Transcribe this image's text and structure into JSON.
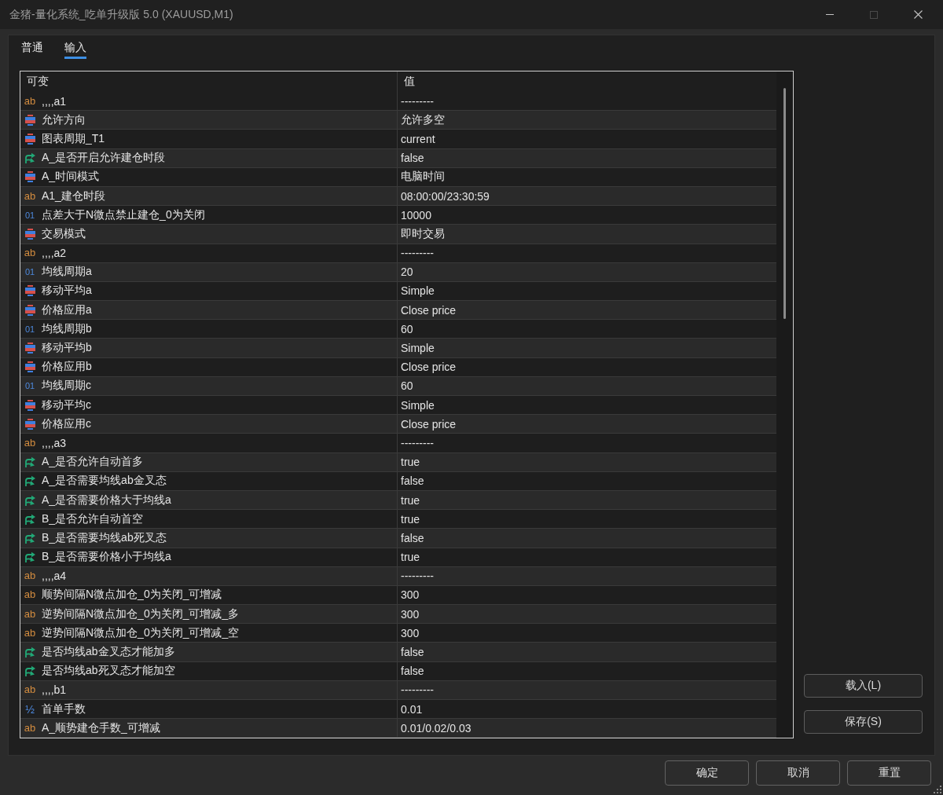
{
  "window": {
    "title": "金猪-量化系统_吃单升级版 5.0 (XAUUSD,M1)",
    "maximize_enabled": false
  },
  "tabs": [
    {
      "label": "普通",
      "selected": false
    },
    {
      "label": "输入",
      "selected": true
    }
  ],
  "table": {
    "columns": [
      "可变",
      "值"
    ],
    "rows": [
      {
        "kind": "string",
        "type_icon": "ab",
        "name": ",,,,a1",
        "value": "---------"
      },
      {
        "kind": "enum",
        "name": "允许方向",
        "value": "允许多空"
      },
      {
        "kind": "enum",
        "name": "图表周期_T1",
        "value": "current"
      },
      {
        "kind": "bool",
        "name": "A_是否开启允许建仓时段",
        "value": "false"
      },
      {
        "kind": "enum",
        "name": "A_时间模式",
        "value": "电脑时间"
      },
      {
        "kind": "string",
        "type_icon": "ab",
        "name": "A1_建仓时段",
        "value": "08:00:00/23:30:59"
      },
      {
        "kind": "int",
        "type_icon": "01",
        "name": "点差大于N微点禁止建仓_0为关闭",
        "value": "10000"
      },
      {
        "kind": "enum",
        "name": "交易模式",
        "value": "即时交易"
      },
      {
        "kind": "string",
        "type_icon": "ab",
        "name": ",,,,a2",
        "value": "---------"
      },
      {
        "kind": "int",
        "type_icon": "01",
        "name": "均线周期a",
        "value": "20"
      },
      {
        "kind": "enum",
        "name": "移动平均a",
        "value": "Simple"
      },
      {
        "kind": "enum",
        "name": "价格应用a",
        "value": "Close price"
      },
      {
        "kind": "int",
        "type_icon": "01",
        "name": "均线周期b",
        "value": "60"
      },
      {
        "kind": "enum",
        "name": "移动平均b",
        "value": "Simple"
      },
      {
        "kind": "enum",
        "name": "价格应用b",
        "value": "Close price"
      },
      {
        "kind": "int",
        "type_icon": "01",
        "name": "均线周期c",
        "value": "60"
      },
      {
        "kind": "enum",
        "name": "移动平均c",
        "value": "Simple"
      },
      {
        "kind": "enum",
        "name": "价格应用c",
        "value": "Close price"
      },
      {
        "kind": "string",
        "type_icon": "ab",
        "name": ",,,,a3",
        "value": "---------"
      },
      {
        "kind": "bool",
        "name": "A_是否允许自动首多",
        "value": "true"
      },
      {
        "kind": "bool",
        "name": "A_是否需要均线ab金叉态",
        "value": "false"
      },
      {
        "kind": "bool",
        "name": "A_是否需要价格大于均线a",
        "value": "true"
      },
      {
        "kind": "bool",
        "name": "B_是否允许自动首空",
        "value": "true"
      },
      {
        "kind": "bool",
        "name": "B_是否需要均线ab死叉态",
        "value": "false"
      },
      {
        "kind": "bool",
        "name": "B_是否需要价格小于均线a",
        "value": "true"
      },
      {
        "kind": "string",
        "type_icon": "ab",
        "name": ",,,,a4",
        "value": "---------"
      },
      {
        "kind": "string",
        "type_icon": "ab",
        "name": "顺势间隔N微点加仓_0为关闭_可增减",
        "value": "300"
      },
      {
        "kind": "string",
        "type_icon": "ab",
        "name": "逆势间隔N微点加仓_0为关闭_可增减_多",
        "value": "300"
      },
      {
        "kind": "string",
        "type_icon": "ab",
        "name": "逆势间隔N微点加仓_0为关闭_可增减_空",
        "value": "300"
      },
      {
        "kind": "bool",
        "name": "是否均线ab金叉态才能加多",
        "value": "false"
      },
      {
        "kind": "bool",
        "name": "是否均线ab死叉态才能加空",
        "value": "false"
      },
      {
        "kind": "string",
        "type_icon": "ab",
        "name": ",,,,b1",
        "value": "---------"
      },
      {
        "kind": "double",
        "type_icon": "½",
        "name": "首单手数",
        "value": "0.01"
      },
      {
        "kind": "string",
        "type_icon": "ab",
        "name": "A_顺势建仓手数_可增减",
        "value": "0.01/0.02/0.03"
      }
    ]
  },
  "side_buttons": [
    "载入(L)",
    "保存(S)"
  ],
  "buttons": [
    "确定",
    "取消",
    "重置"
  ]
}
